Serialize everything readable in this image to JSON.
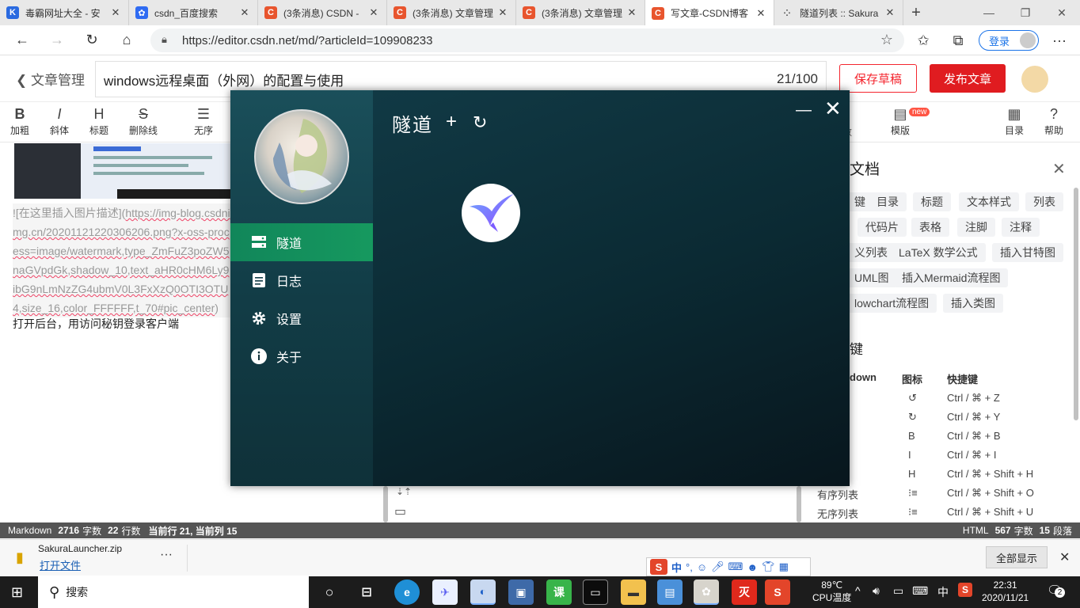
{
  "browser": {
    "tabs": [
      {
        "title": "毒霸网址大全 - 安",
        "icon": "kingsoft-icon",
        "color": "#2a6ae0",
        "glyph": "K"
      },
      {
        "title": "csdn_百度搜索",
        "icon": "baidu-icon",
        "color": "#2f6bf2",
        "glyph": "✿"
      },
      {
        "title": "(3条消息) CSDN -",
        "icon": "csdn-icon",
        "color": "#e8552e",
        "glyph": "C"
      },
      {
        "title": "(3条消息) 文章管理",
        "icon": "csdn-icon",
        "color": "#e8552e",
        "glyph": "C"
      },
      {
        "title": "(3条消息) 文章管理",
        "icon": "csdn-icon",
        "color": "#e8552e",
        "glyph": "C"
      },
      {
        "title": "写文章-CSDN博客",
        "icon": "csdn-icon",
        "color": "#e8552e",
        "glyph": "C",
        "active": true
      },
      {
        "title": "隧道列表 :: Sakura",
        "icon": "loading-icon",
        "color": "#e8e8e8",
        "glyph": "⁘"
      }
    ],
    "new_tab": "+",
    "url": "https://editor.csdn.net/md/?articleId=109908233",
    "login_label": "登录"
  },
  "editor": {
    "back_label": "文章管理",
    "title": "windows远程桌面（外网）的配置与使用",
    "title_count": "21/100",
    "save_draft": "保存草稿",
    "publish": "发布文章",
    "toolbar": [
      {
        "glyph": "B",
        "label": "加粗"
      },
      {
        "glyph": "I",
        "label": "斜体"
      },
      {
        "glyph": "H",
        "label": "标题"
      },
      {
        "glyph": "S",
        "label": "删除线"
      },
      {
        "glyph": "☰",
        "label": "无序"
      }
    ],
    "toolbar_right": [
      {
        "glyph": "▤",
        "label": "模版",
        "badge": "new"
      },
      {
        "glyph": "▦",
        "label": "目录"
      },
      {
        "glyph": "?",
        "label": "帮助"
      }
    ],
    "toolbar_partial": "数",
    "markdown_text_prefix": "![在这里插入图片描述](",
    "markdown_text_link": "https://img-blog.csdnimg.cn/20201121220306206.png?x-oss-process=image/watermark,type_ZmFuZ3poZW5naGVpdGk,shadow_10,text_aHR0cHM6Ly9ibG9nLmNzZG4ubmV0L3FxXzQ0OTI3OTU4,size_16,color_FFFFFF,t_70#pic_center",
    "markdown_text_suffix": ")",
    "paragraph": "打开后台，用访问秘钥登录客户端",
    "help_panel": {
      "title": "文档",
      "chips": [
        "键",
        "目录",
        "标题",
        "文本样式",
        "列表",
        "代码片",
        "表格",
        "注脚",
        "注释",
        "义列表",
        "LaTeX 数学公式",
        "插入甘特图",
        "UML图",
        "插入Mermaid流程图",
        "lowchart流程图",
        "插入类图"
      ],
      "shortcuts_title": "键",
      "headers": [
        "down",
        "图标",
        "快捷键"
      ],
      "rows": [
        {
          "name": "",
          "icon": "↺",
          "keys": "Ctrl / ⌘ + Z"
        },
        {
          "name": "",
          "icon": "↻",
          "keys": "Ctrl / ⌘ + Y"
        },
        {
          "name": "",
          "icon": "B",
          "keys": "Ctrl / ⌘ + B"
        },
        {
          "name": "",
          "icon": "I",
          "keys": "Ctrl / ⌘ + I"
        },
        {
          "name": "",
          "icon": "H",
          "keys": "Ctrl / ⌘ + Shift + H"
        },
        {
          "name": "有序列表",
          "icon": "⁝≡",
          "keys": "Ctrl / ⌘ + Shift + O"
        },
        {
          "name": "无序列表",
          "icon": "⁝≡",
          "keys": "Ctrl / ⌘ + Shift + U"
        }
      ]
    },
    "status_left": {
      "mode": "Markdown",
      "chars": "2716",
      "chars_unit": "字数",
      "lines": "22",
      "lines_unit": "行数",
      "pos": "当前行 21, 当前列 15"
    },
    "status_right": {
      "mode": "HTML",
      "chars": "567",
      "chars_unit": "字数",
      "paras": "15",
      "paras_unit": "段落"
    }
  },
  "download": {
    "file": "SakuraLauncher.zip",
    "action": "打开文件",
    "more": "···",
    "show_all": "全部显示"
  },
  "tunnel_app": {
    "title": "隧道",
    "menu": [
      {
        "label": "隧道",
        "icon": "server-icon",
        "active": true
      },
      {
        "label": "日志",
        "icon": "document-icon"
      },
      {
        "label": "设置",
        "icon": "gear-icon"
      },
      {
        "label": "关于",
        "icon": "info-icon"
      }
    ]
  },
  "ime": {
    "mode": "中",
    "punct": "°,"
  },
  "taskbar": {
    "search": "搜索",
    "cpu_temp": "89℃",
    "cpu_label": "CPU温度",
    "lang": "中",
    "time": "22:31",
    "date": "2020/11/21",
    "notifications": "2"
  }
}
